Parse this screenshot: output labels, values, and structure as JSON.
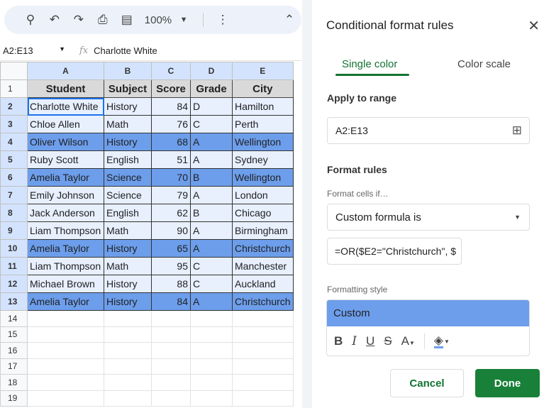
{
  "toolbar": {
    "zoom": "100%"
  },
  "formula_bar": {
    "range": "A2:E13",
    "fx": "fx",
    "value": "Charlotte White"
  },
  "columns": [
    "A",
    "B",
    "C",
    "D",
    "E"
  ],
  "header": [
    "Student",
    "Subject",
    "Score",
    "Grade",
    "City"
  ],
  "rows": [
    {
      "n": "2",
      "v": [
        "Charlotte White",
        "History",
        "84",
        "D",
        "Hamilton"
      ],
      "hl": false
    },
    {
      "n": "3",
      "v": [
        "Chloe Allen",
        "Math",
        "76",
        "C",
        "Perth"
      ],
      "hl": false
    },
    {
      "n": "4",
      "v": [
        "Oliver Wilson",
        "History",
        "68",
        "A",
        "Wellington"
      ],
      "hl": true
    },
    {
      "n": "5",
      "v": [
        "Ruby Scott",
        "English",
        "51",
        "A",
        "Sydney"
      ],
      "hl": false
    },
    {
      "n": "6",
      "v": [
        "Amelia Taylor",
        "Science",
        "70",
        "B",
        "Wellington"
      ],
      "hl": true
    },
    {
      "n": "7",
      "v": [
        "Emily Johnson",
        "Science",
        "79",
        "A",
        "London"
      ],
      "hl": false
    },
    {
      "n": "8",
      "v": [
        "Jack Anderson",
        "English",
        "62",
        "B",
        "Chicago"
      ],
      "hl": false
    },
    {
      "n": "9",
      "v": [
        "Liam Thompson",
        "Math",
        "90",
        "A",
        "Birmingham"
      ],
      "hl": false
    },
    {
      "n": "10",
      "v": [
        "Amelia Taylor",
        "History",
        "65",
        "A",
        "Christchurch"
      ],
      "hl": true
    },
    {
      "n": "11",
      "v": [
        "Liam Thompson",
        "Math",
        "95",
        "C",
        "Manchester"
      ],
      "hl": false
    },
    {
      "n": "12",
      "v": [
        "Michael Brown",
        "History",
        "88",
        "C",
        "Auckland"
      ],
      "hl": false
    },
    {
      "n": "13",
      "v": [
        "Amelia Taylor",
        "History",
        "84",
        "A",
        "Christchurch"
      ],
      "hl": true
    }
  ],
  "empty_rows": [
    "14",
    "15",
    "16",
    "17",
    "18",
    "19"
  ],
  "panel": {
    "title": "Conditional format rules",
    "tabs": [
      "Single color",
      "Color scale"
    ],
    "apply_label": "Apply to range",
    "range": "A2:E13",
    "rules_label": "Format rules",
    "cells_if": "Format cells if…",
    "condition": "Custom formula is",
    "formula": "=OR($E2=\"Christchurch\", $",
    "style_label": "Formatting style",
    "style_name": "Custom",
    "style_color": "#6d9eeb",
    "cancel": "Cancel",
    "done": "Done"
  }
}
